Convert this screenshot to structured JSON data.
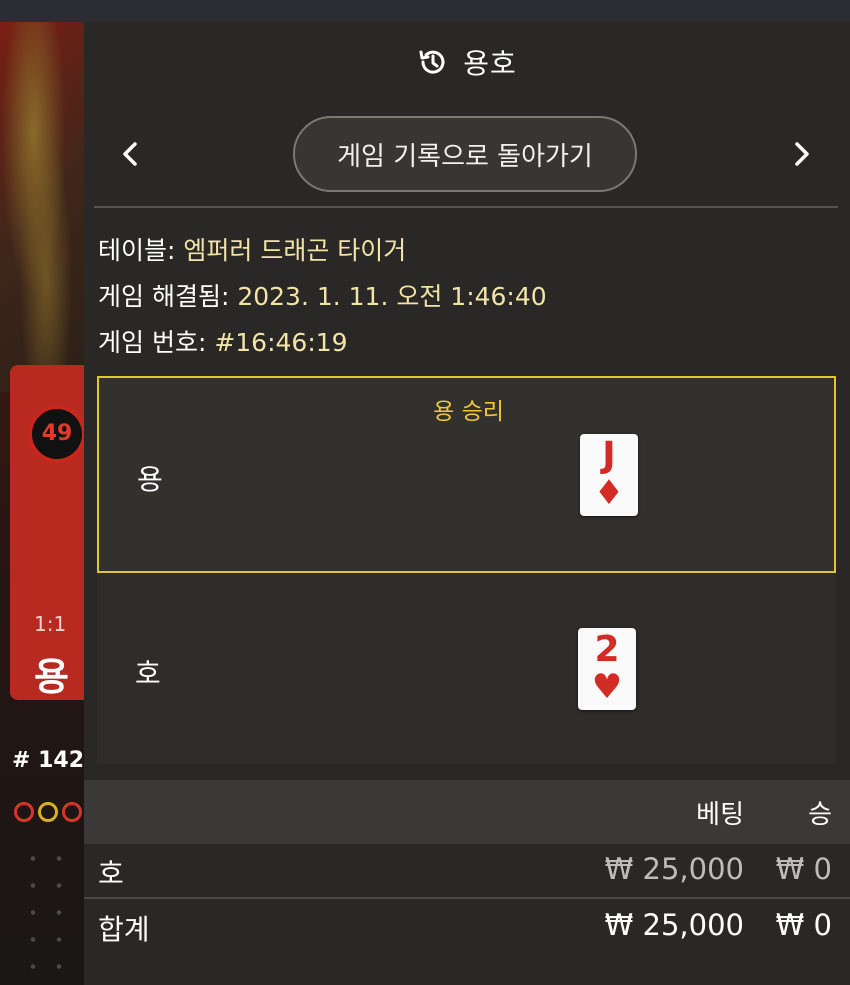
{
  "header": {
    "title": "용호"
  },
  "nav": {
    "back_label": "게임 기록으로 돌아가기"
  },
  "info": [
    {
      "label": "테이블: ",
      "value": "엠퍼러 드래곤 타이거"
    },
    {
      "label": "게임 해결됨: ",
      "value": "2023. 1. 11. 오전 1:46:40"
    },
    {
      "label": "게임 번호: ",
      "value": "#16:46:19"
    }
  ],
  "result": {
    "dragon": {
      "label": "용",
      "win_label": "용 승리",
      "card": {
        "rank": "J",
        "suit": "♦"
      }
    },
    "tiger": {
      "label": "호",
      "card": {
        "rank": "2",
        "suit": "♥"
      }
    }
  },
  "bets": {
    "headers": {
      "bet": "베팅",
      "win": "승"
    },
    "rows": [
      {
        "name": "호",
        "bet": "₩ 25,000",
        "win": "₩ 0"
      }
    ],
    "total": {
      "name": "합계",
      "bet": "₩ 25,000",
      "win": "₩ 0"
    }
  },
  "background": {
    "percent": "49",
    "odds": "1:1",
    "dragon_label": "용",
    "round": "# 142"
  },
  "colors": {
    "accent_gold": "#e4c62b",
    "win_text": "#f1c83a",
    "info_value": "#f2e4a6",
    "card_red": "#d32b25",
    "panel_bg": "#292826"
  }
}
